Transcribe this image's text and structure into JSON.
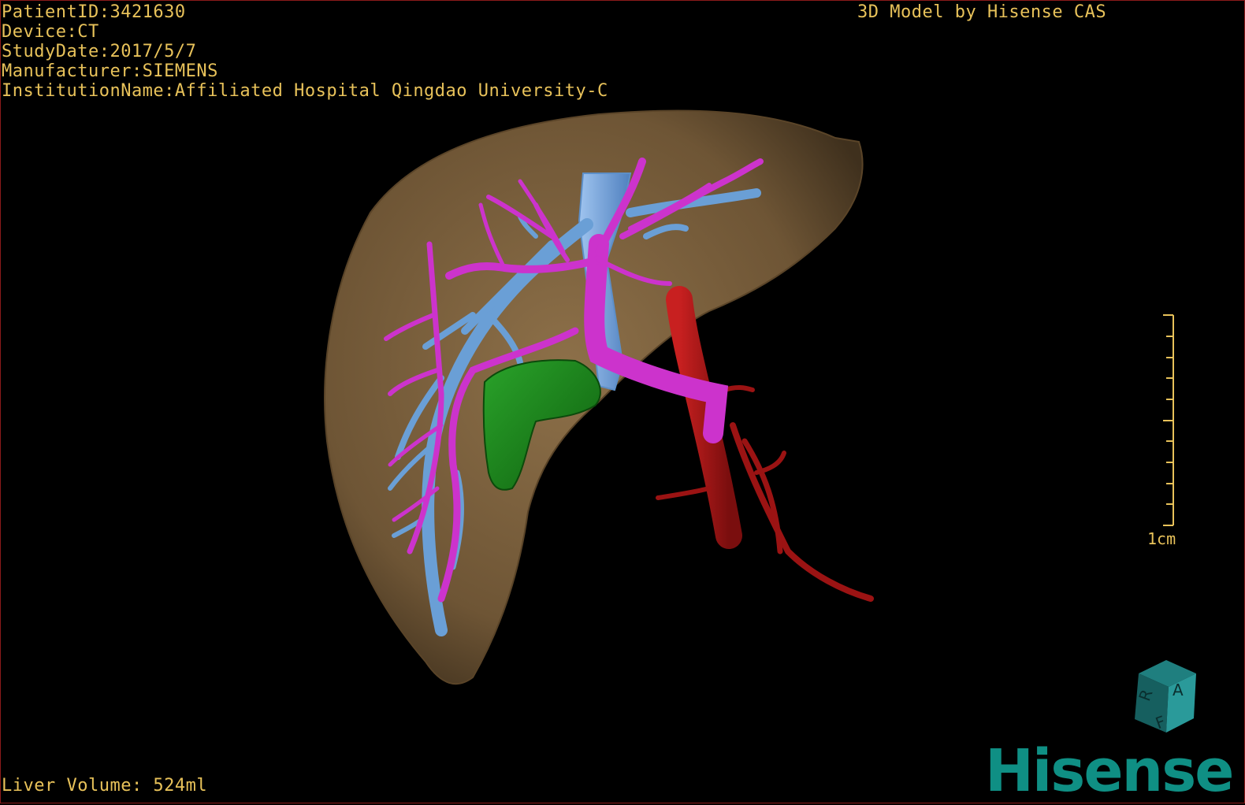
{
  "patient_info": {
    "patient_id": "PatientID:3421630",
    "device": "Device:CT",
    "study_date": "StudyDate:2017/5/7",
    "manufacturer": "Manufacturer:SIEMENS",
    "institution": "InstitutionName:Affiliated Hospital Qingdao University-C"
  },
  "header_right": "3D Model by Hisense CAS",
  "liver_volume": "Liver Volume: 524ml",
  "scale_bar": {
    "label": "1cm"
  },
  "orientation_cube": {
    "faces": [
      "A",
      "R",
      "F"
    ]
  },
  "logo_text": "Hisense",
  "colors": {
    "overlay_text": "#e8c25a",
    "liver": "#7a5e3e",
    "hepatic_vein": "#6a9fd6",
    "portal_vein": "#cc33cc",
    "tumor": "#1e8a1e",
    "artery": "#a01414",
    "logo": "#0f8f84"
  }
}
